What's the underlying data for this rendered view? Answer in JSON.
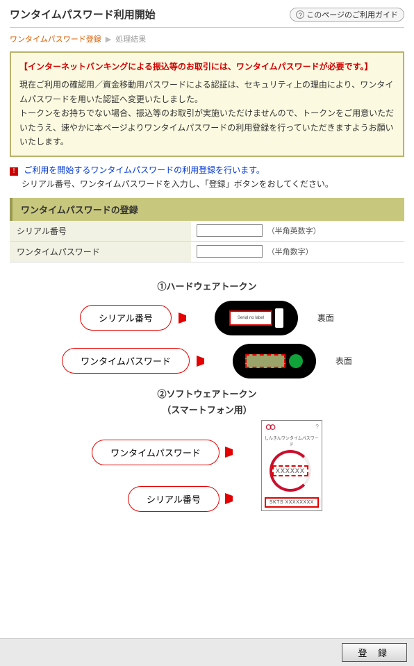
{
  "header": {
    "page_title": "ワンタイムパスワード利用開始",
    "guide_label": "このページのご利用ガイド"
  },
  "breadcrumb": {
    "step1": "ワンタイムパスワード登録",
    "step2": "処理結果"
  },
  "notice": {
    "headline": "【インターネットバンキングによる振込等のお取引には、ワンタイムパスワードが必要です。】",
    "line1": "現在ご利用の確認用／資金移動用パスワードによる認証は、セキュリティ上の理由により、ワンタイムパスワードを用いた認証へ変更いたしました。",
    "line2": "トークンをお持ちでない場合、振込等のお取引が実施いただけませんので、トークンをご用意いただいたうえ、速やかに本ページよりワンタイムパスワードの利用登録を行っていただきますようお願いいたします。"
  },
  "instructions": {
    "line1": "ご利用を開始するワンタイムパスワードの利用登録を行います。",
    "line2": "シリアル番号、ワンタイムパスワードを入力し、「登録」ボタンをおしてください。"
  },
  "section_title": "ワンタイムパスワードの登録",
  "form": {
    "serial_label": "シリアル番号",
    "serial_value": "",
    "serial_hint": "（半角英数字）",
    "otp_label": "ワンタイムパスワード",
    "otp_value": "",
    "otp_hint": "（半角数字）"
  },
  "diagram": {
    "hw_title": "①ハードウェアトークン",
    "sw_title": "②ソフトウェアトークン",
    "sw_sub": "（スマートフォン用）",
    "callout_serial": "シリアル番号",
    "callout_otp": "ワンタイムパスワード",
    "back_label": "裏面",
    "front_label": "表面",
    "token_sn_text": "Serial no label",
    "phone_small": "しんきんワンタイムパスワード",
    "phone_otp": "XXXXXX",
    "phone_sn": "SKTS XXXXXXXX"
  },
  "footer": {
    "submit_label": "登 録"
  }
}
